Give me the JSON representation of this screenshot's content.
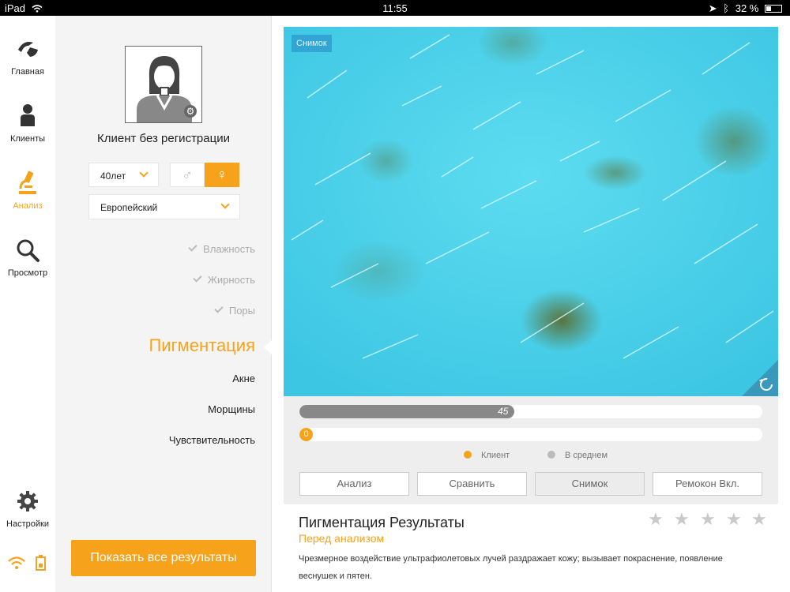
{
  "status": {
    "carrier": "iPad",
    "time": "11:55",
    "battery": "32 %"
  },
  "nav": {
    "items": [
      {
        "label": "Главная"
      },
      {
        "label": "Клиенты"
      },
      {
        "label": "Анализ"
      },
      {
        "label": "Просмотр"
      }
    ],
    "settings": "Настройки"
  },
  "client": {
    "name": "Клиент без регистрации",
    "age": "40лет",
    "ethnicity": "Европейский",
    "gender_male": "♂",
    "gender_female": "♀"
  },
  "categories": {
    "moisture": "Влажность",
    "oiliness": "Жирность",
    "pores": "Поры",
    "pigmentation": "Пигментация",
    "acne": "Акне",
    "wrinkles": "Морщины",
    "sensitivity": "Чувствительность"
  },
  "show_all": "Показать все результаты",
  "photo": {
    "tag": "Снимок"
  },
  "bars": {
    "average_value": "45",
    "average_fraction": 0.465,
    "client_value": "0"
  },
  "legend": {
    "client": "Клиент",
    "average": "В среднем"
  },
  "buttons": {
    "analyze": "Анализ",
    "compare": "Сравнить",
    "snapshot": "Снимок",
    "remocon": "Ремокон Вкл."
  },
  "result": {
    "title": "Пигментация Результаты",
    "subtitle": "Перед анализом",
    "description": "Чрезмерное воздействие ультрафиолетовых лучей раздражает кожу; вызывает покраснение, появление веснушек и пятен.",
    "stars": 0,
    "stars_max": 5
  },
  "colors": {
    "accent": "#f7a21b",
    "photo": "#49d4ea",
    "average_bar": "#888888"
  }
}
